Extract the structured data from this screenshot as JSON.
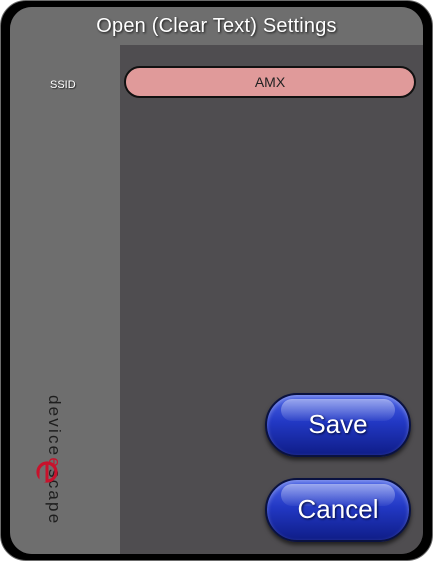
{
  "dialog": {
    "title": "Open (Clear Text) Settings"
  },
  "fields": {
    "ssid_label": "SSID",
    "ssid_value": "AMX"
  },
  "buttons": {
    "save_label": "Save",
    "cancel_label": "Cancel"
  },
  "logo": {
    "name_prefix": "device",
    "name_accent": "e",
    "name_suffix": "scape",
    "mark_icon": "devicescape-e-icon"
  },
  "colors": {
    "ssid_field": "#e09a9a",
    "button": "#2238c4",
    "logo_accent": "#c8122c"
  }
}
